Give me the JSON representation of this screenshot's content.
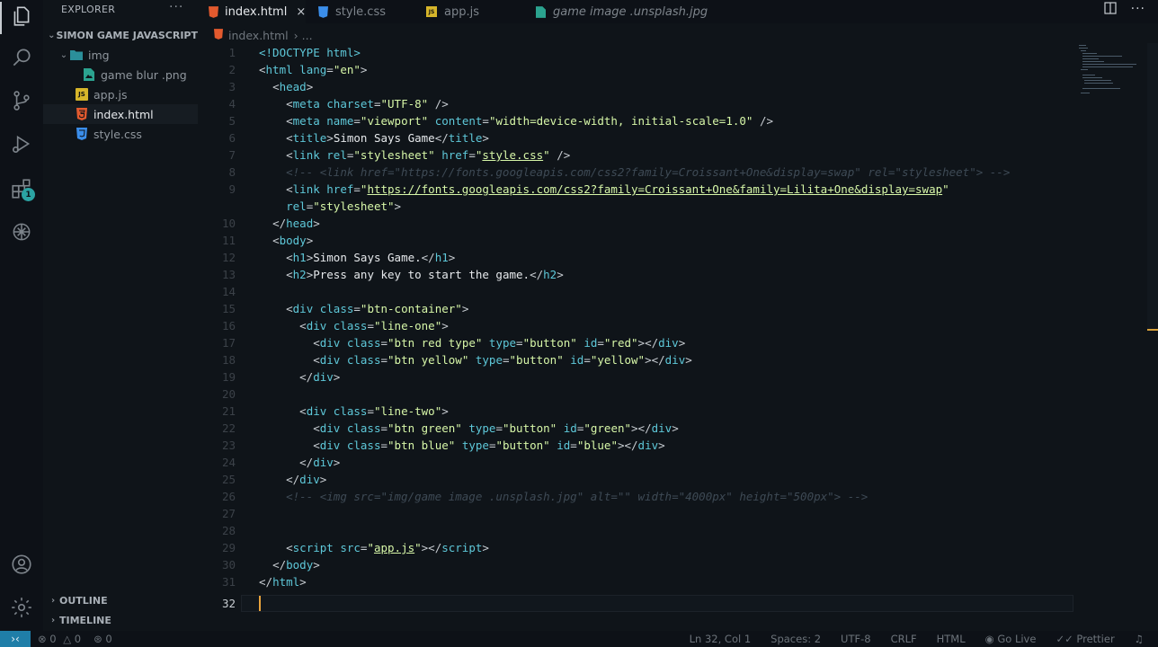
{
  "sidebar": {
    "title": "EXPLORER",
    "menu": "···",
    "project": "SIMON GAME JAVASCRIPT",
    "folder": "img",
    "files": {
      "image": "game blur .png",
      "js": "app.js",
      "html": "index.html",
      "css": "style.css"
    },
    "outline": "OUTLINE",
    "timeline": "TIMELINE",
    "badge": "1"
  },
  "tabs": {
    "tab1": "index.html",
    "tab2": "style.css",
    "tab3": "app.js",
    "tab4": "game image .unsplash.jpg",
    "close": "×"
  },
  "breadcrumb": {
    "file": "index.html",
    "more": "› ..."
  },
  "editor": {
    "current_line": "32",
    "code": {
      "l1_tag": "<!DOCTYPE html>",
      "html": "html",
      "lang": "lang",
      "en": "\"en\"",
      "head": "head",
      "meta": "meta",
      "charset": "charset",
      "utf8": "\"UTF-8\"",
      "name": "name",
      "viewport": "\"viewport\"",
      "content": "content",
      "content_val": "\"width=device-width, initial-scale=1.0\"",
      "title": "title",
      "title_text": "Simon Says Game",
      "link": "link",
      "rel": "rel",
      "stylesheet": "\"stylesheet\"",
      "href": "href",
      "stylecss": "style.css",
      "comment1": "<!-- <link href=\"https://fonts.googleapis.com/css2?family=Croissant+One&display=swap\" rel=\"stylesheet\"> -->",
      "fonts_url": "https://fonts.googleapis.com/css2?family=Croissant+One&family=Lilita+One&display=swap",
      "body": "body",
      "h1": "h1",
      "h1_text": "Simon Says Game.",
      "h2": "h2",
      "h2_text": "Press any key to start the game.",
      "div": "div",
      "class": "class",
      "type": "type",
      "id": "id",
      "btn_container": "\"btn-container\"",
      "line_one": "\"line-one\"",
      "btn_red": "\"btn red type\"",
      "button": "\"button\"",
      "red": "\"red\"",
      "btn_yellow": "\"btn yellow\"",
      "yellow": "\"yellow\"",
      "line_two": "\"line-two\"",
      "btn_green": "\"btn green\"",
      "green": "\"green\"",
      "btn_blue": "\"btn blue\"",
      "blue": "\"blue\"",
      "comment2": "<!-- <img src=\"img/game image .unsplash.jpg\" alt=\"\" width=\"4000px\" height=\"500px\"> -->",
      "script": "script",
      "src": "src",
      "appjs": "app.js"
    }
  },
  "status": {
    "errors": "0",
    "warnings": "0",
    "ports": "0",
    "position": "Ln 32, Col 1",
    "spaces": "Spaces: 2",
    "encoding": "UTF-8",
    "eol": "CRLF",
    "language": "HTML",
    "golive": "Go Live",
    "prettier": "Prettier"
  }
}
